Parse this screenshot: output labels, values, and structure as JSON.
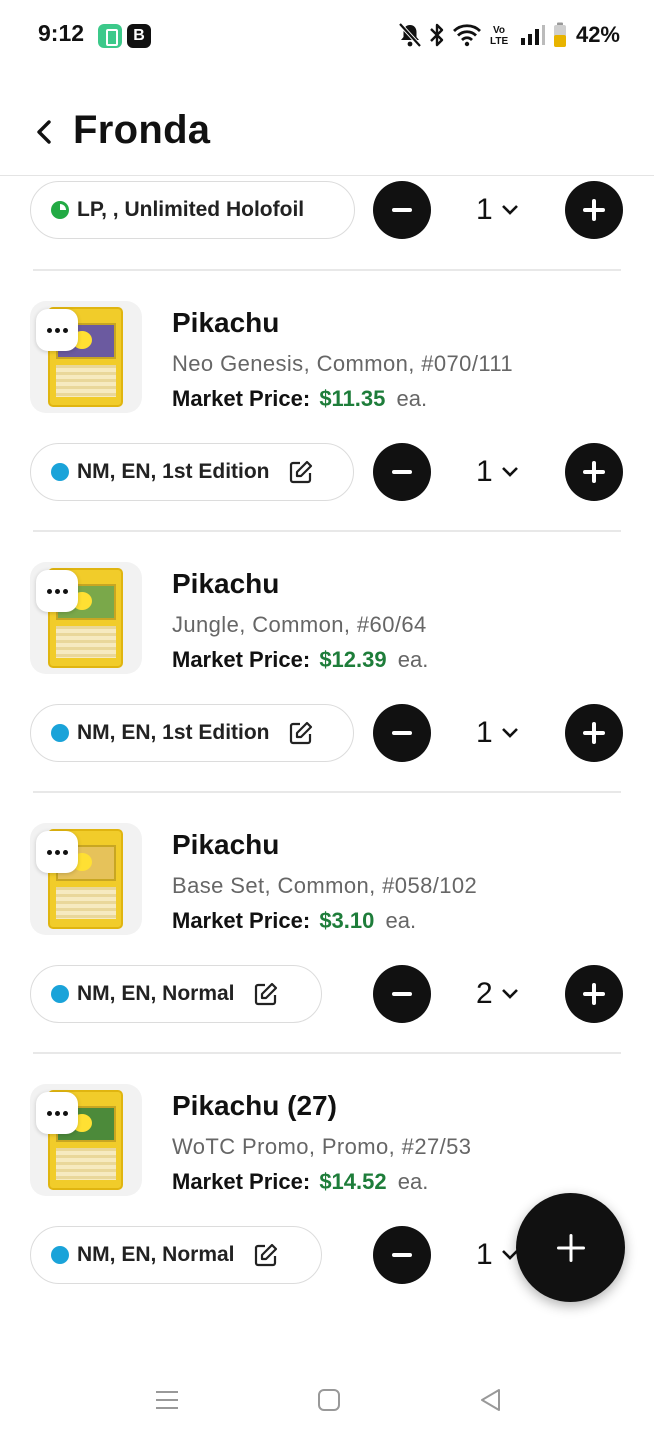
{
  "status_bar": {
    "time": "9:12",
    "notif_b": "B",
    "battery_percent": "42%",
    "icons": [
      "notifications-off-icon",
      "bluetooth-icon",
      "wifi-icon",
      "volte-icon",
      "signal-icon",
      "battery-icon"
    ]
  },
  "header": {
    "title": "Fronda",
    "back_icon": "chevron-left-icon"
  },
  "top_partial_item": {
    "condition": "LP, , Unlimited Holofoil",
    "condition_color": "#22aa44",
    "quantity": "1"
  },
  "items": [
    {
      "name": "Pikachu",
      "meta": "Neo Genesis, Common, #070/111",
      "price_label": "Market Price:",
      "price": "$11.35",
      "price_unit": "ea.",
      "condition": "NM, EN, 1st Edition",
      "quantity": "1"
    },
    {
      "name": "Pikachu",
      "meta": "Jungle, Common, #60/64",
      "price_label": "Market Price:",
      "price": "$12.39",
      "price_unit": "ea.",
      "condition": "NM, EN, 1st Edition",
      "quantity": "1"
    },
    {
      "name": "Pikachu",
      "meta": "Base Set, Common, #058/102",
      "price_label": "Market Price:",
      "price": "$3.10",
      "price_unit": "ea.",
      "condition": "NM, EN, Normal",
      "quantity": "2"
    },
    {
      "name": "Pikachu (27)",
      "meta": "WoTC Promo, Promo, #27/53",
      "price_label": "Market Price:",
      "price": "$14.52",
      "price_unit": "ea.",
      "condition": "NM, EN, Normal",
      "quantity": "1"
    }
  ],
  "colors": {
    "price_green": "#1e7d3a",
    "nm_dot": "#1aa3d9",
    "button_dark": "#111111"
  }
}
